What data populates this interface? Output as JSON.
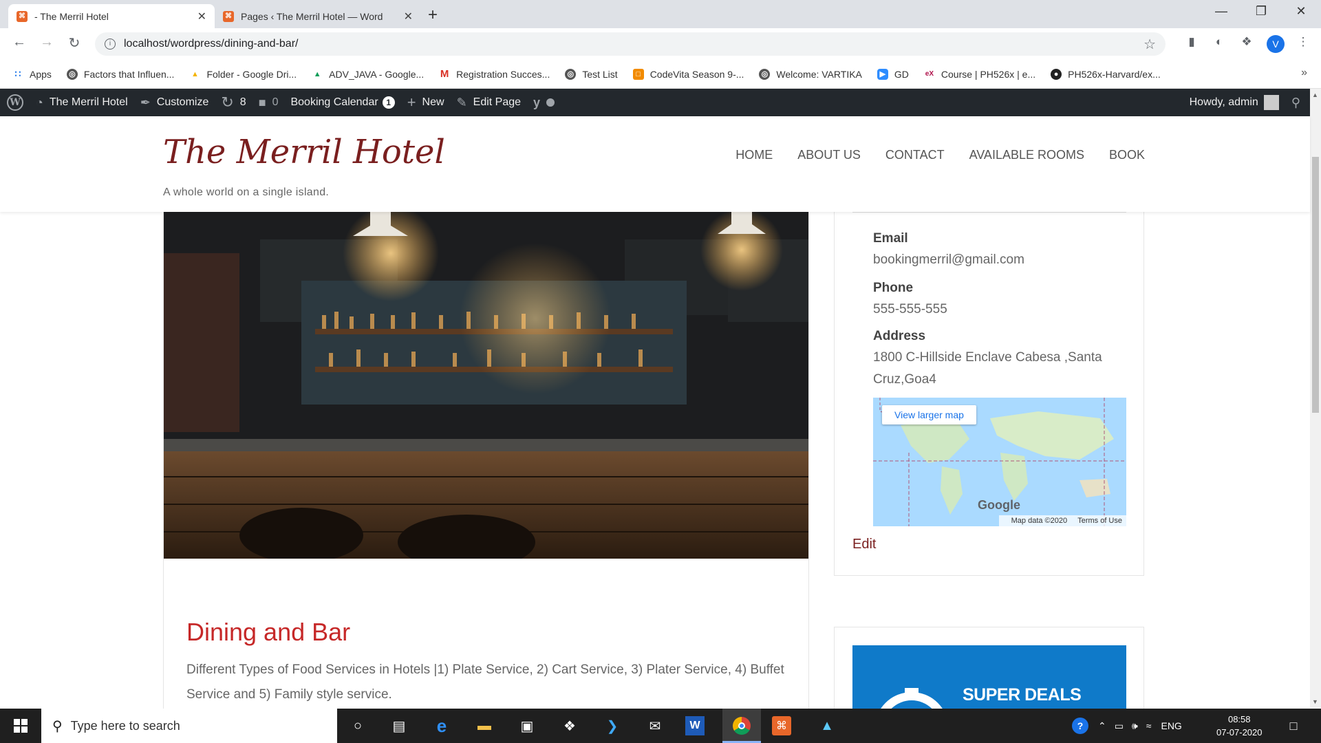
{
  "browser": {
    "tabs": [
      {
        "title": "- The Merril Hotel",
        "active": true
      },
      {
        "title": "Pages ‹ The Merril Hotel — Word",
        "active": false
      }
    ],
    "url": "localhost/wordpress/dining-and-bar/",
    "profile_initial": "V",
    "bookmarks": [
      {
        "label": "Apps",
        "icon": "apps-grid-icon"
      },
      {
        "label": "Factors that Influen...",
        "icon": "globe-icon"
      },
      {
        "label": "Folder - Google Dri...",
        "icon": "google-drive-icon"
      },
      {
        "label": "ADV_JAVA - Google...",
        "icon": "google-drive-icon"
      },
      {
        "label": "Registration Succes...",
        "icon": "gmail-icon"
      },
      {
        "label": "Test List",
        "icon": "globe-icon"
      },
      {
        "label": "CodeVita Season 9-...",
        "icon": "codevita-icon"
      },
      {
        "label": "Welcome: VARTIKA",
        "icon": "globe-icon"
      },
      {
        "label": "GD",
        "icon": "zoom-icon"
      },
      {
        "label": "Course | PH526x | e...",
        "icon": "edx-icon"
      },
      {
        "label": "PH526x-Harvard/ex...",
        "icon": "github-icon"
      }
    ]
  },
  "adminbar": {
    "site_name": "The Merril Hotel",
    "customize": "Customize",
    "updates_count": "8",
    "comments_count": "0",
    "booking_calendar": "Booking Calendar",
    "booking_badge": "1",
    "new": "New",
    "edit_page": "Edit Page",
    "howdy": "Howdy, admin"
  },
  "site": {
    "title": "The Merril Hotel",
    "tagline": "A whole world on a single island.",
    "nav": [
      "HOME",
      "ABOUT US",
      "CONTACT",
      "AVAILABLE ROOMS",
      "BOOK"
    ]
  },
  "page": {
    "title": "Dining and Bar",
    "text": "Different Types of Food Services in Hotels |1) Plate Service, 2) Cart Service, 3) Plater Service, 4) Buffet Service and 5) Family style service."
  },
  "sidebar": {
    "email_label": "Email",
    "email": "bookingmerril@gmail.com",
    "phone_label": "Phone",
    "phone": "555-555-555",
    "address_label": "Address",
    "address": "1800 C-Hillside Enclave Cabesa ,Santa Cruz,Goa4",
    "map": {
      "view_larger": "View larger map",
      "google": "Google",
      "map_data": "Map data ©2020",
      "terms": "Terms of Use"
    },
    "edit": "Edit",
    "ad_text": "SUPER DEALS"
  },
  "taskbar": {
    "search_placeholder": "Type here to search",
    "language": "ENG",
    "time": "08:58",
    "date": "07-07-2020"
  },
  "colors": {
    "site_title": "#7a1f1f",
    "entry_title": "#c62828",
    "adminbar_bg": "#23282d",
    "ad_bg": "#0f7ac9"
  }
}
